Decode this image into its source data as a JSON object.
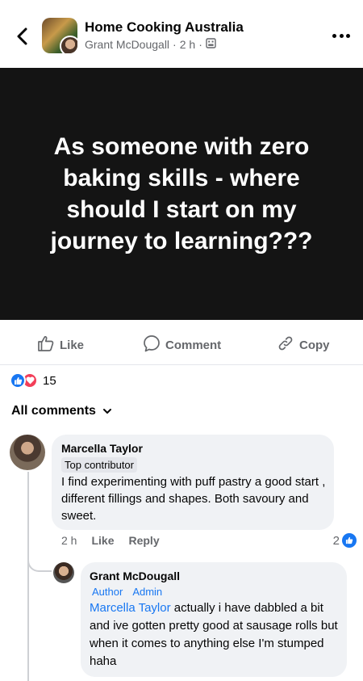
{
  "header": {
    "group_name": "Home Cooking Australia",
    "author": "Grant McDougall",
    "separator": "·",
    "time": "2 h",
    "separator2": "·",
    "icons": [
      "back-icon",
      "group-icon",
      "more-icon"
    ]
  },
  "post": {
    "text": "As someone with zero baking skills - where should I start on my journey to learning???",
    "background": "#141414"
  },
  "actions": {
    "like": "Like",
    "comment": "Comment",
    "copy": "Copy"
  },
  "reactions": {
    "count": "15",
    "types": [
      "like",
      "love"
    ]
  },
  "comments_filter": {
    "label": "All comments"
  },
  "comments": [
    {
      "author": "Marcella Taylor",
      "badge": "Top contributor",
      "text": "I find experimenting with puff pastry a good start , different fillings and shapes. Both savoury and sweet.",
      "time": "2 h",
      "like": "Like",
      "reply": "Reply",
      "reaction_count": "2"
    },
    {
      "author": "Grant McDougall",
      "tags": [
        "Author",
        "Admin"
      ],
      "mention": "Marcella Taylor",
      "text": " actually i have dabbled a bit and ive gotten pretty good at sausage rolls but when it comes to anything else I'm stumped haha"
    }
  ],
  "colors": {
    "accent": "#1877f2",
    "love": "#f33e58",
    "secondary_text": "#65676b",
    "bubble": "#f0f2f5"
  }
}
